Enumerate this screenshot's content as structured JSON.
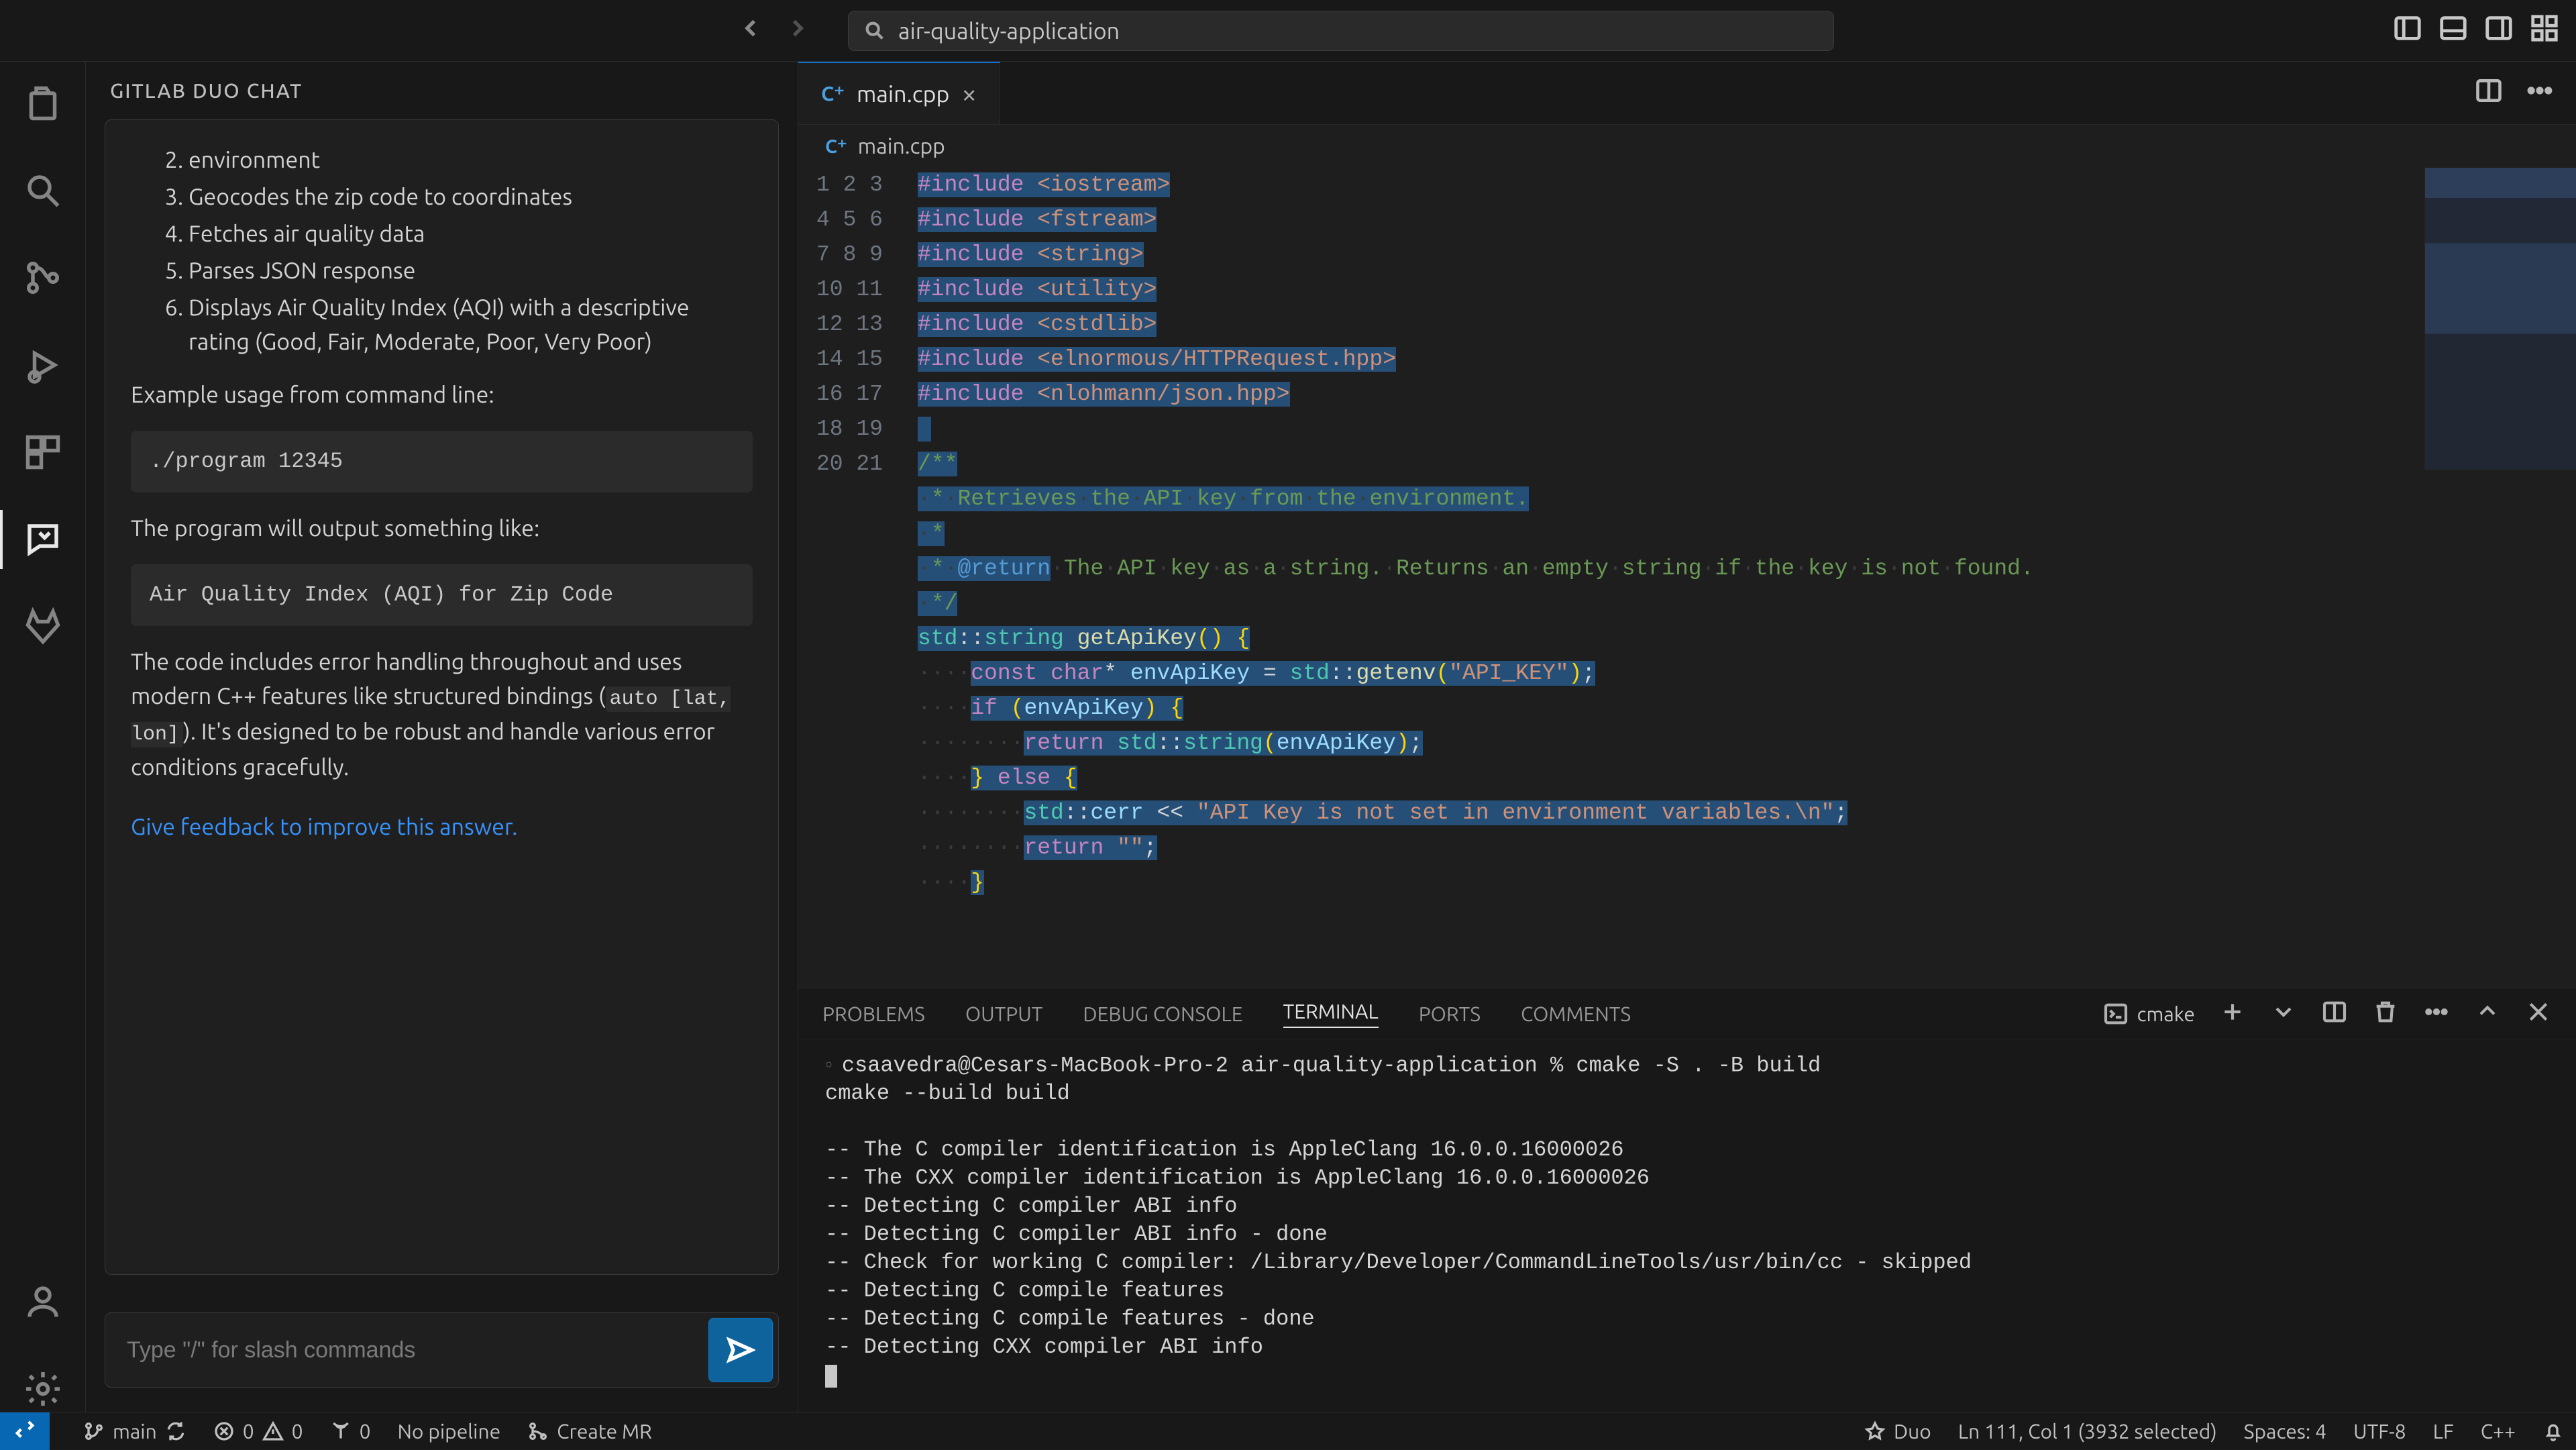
{
  "title_bar": {
    "search_text": "air-quality-application"
  },
  "side_panel": {
    "title": "GITLAB DUO CHAT",
    "list": {
      "i2": "environment",
      "i3": "Geocodes the zip code to coordinates",
      "i4": "Fetches air quality data",
      "i5": "Parses JSON response",
      "i6": "Displays Air Quality Index (AQI) with a descriptive rating (Good, Fair, Moderate, Poor, Very Poor)"
    },
    "example_label": "Example usage from command line:",
    "example_block": "./program 12345",
    "output_label": "The program will output something like:",
    "output_block": "Air Quality Index (AQI) for Zip Code",
    "closing_pre": "The code includes error handling throughout and uses modern C++ features like structured bindings (",
    "closing_code": "auto [lat, lon]",
    "closing_post": "). It's designed to be robust and handle various error conditions gracefully.",
    "feedback": "Give feedback to improve this answer.",
    "input_placeholder": "Type \"/\" for slash commands"
  },
  "editor": {
    "tab_label": "main.cpp",
    "breadcrumb": "main.cpp",
    "line_count": 21
  },
  "panel": {
    "tabs": {
      "problems": "PROBLEMS",
      "output": "OUTPUT",
      "debug": "DEBUG CONSOLE",
      "terminal": "TERMINAL",
      "ports": "PORTS",
      "comments": "COMMENTS"
    },
    "terminal_name": "cmake",
    "terminal_lines": [
      "csaavedra@Cesars-MacBook-Pro-2 air-quality-application % cmake -S . -B build",
      "cmake --build build",
      "",
      "-- The C compiler identification is AppleClang 16.0.0.16000026",
      "-- The CXX compiler identification is AppleClang 16.0.0.16000026",
      "-- Detecting C compiler ABI info",
      "-- Detecting C compiler ABI info - done",
      "-- Check for working C compiler: /Library/Developer/CommandLineTools/usr/bin/cc - skipped",
      "-- Detecting C compile features",
      "-- Detecting C compile features - done",
      "-- Detecting CXX compiler ABI info"
    ]
  },
  "status": {
    "branch": "main",
    "errors": "0",
    "warnings": "0",
    "ports": "0",
    "pipeline": "No pipeline",
    "create_mr": "Create MR",
    "duo": "Duo",
    "cursor": "Ln 111, Col 1 (3932 selected)",
    "spaces": "Spaces: 4",
    "encoding": "UTF-8",
    "eol": "LF",
    "lang": "C++"
  }
}
